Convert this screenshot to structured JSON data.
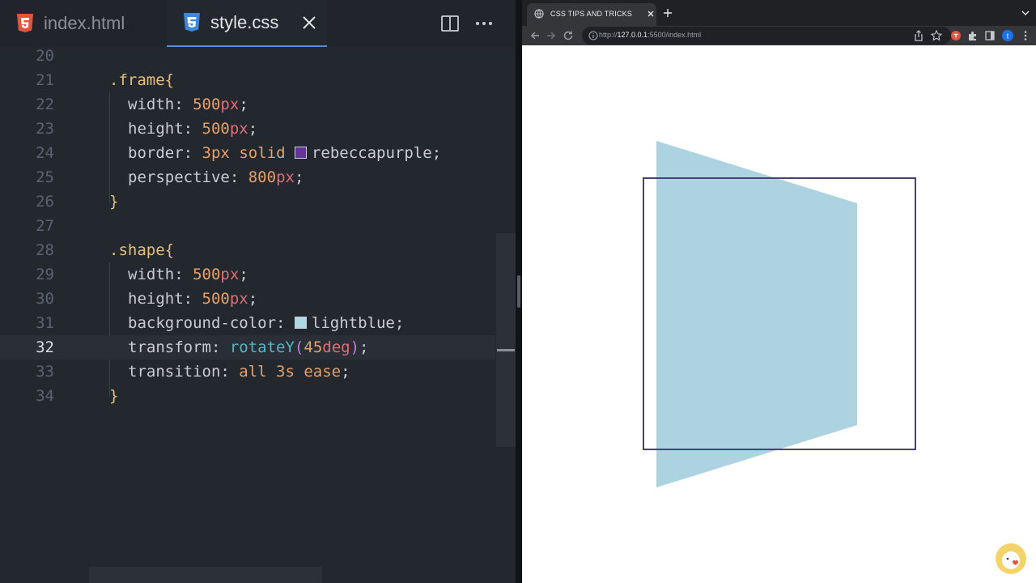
{
  "editor": {
    "tabs": [
      {
        "name": "index.html",
        "icon": "html5-icon"
      },
      {
        "name": "style.css",
        "icon": "css3-icon"
      }
    ],
    "lines": [
      {
        "num": "20"
      },
      {
        "num": "21",
        "selector": ".frame",
        "brace": "{"
      },
      {
        "num": "22",
        "prop": "width",
        "value_num": "500",
        "value_unit": "px"
      },
      {
        "num": "23",
        "prop": "height",
        "value_num": "500",
        "value_unit": "px"
      },
      {
        "num": "24",
        "prop": "border",
        "value_a": "3px",
        "value_b": "solid",
        "color_name": "rebeccapurple",
        "color_hex": "#663399"
      },
      {
        "num": "25",
        "prop": "perspective",
        "value_num": "800",
        "value_unit": "px"
      },
      {
        "num": "26",
        "brace": "}"
      },
      {
        "num": "27"
      },
      {
        "num": "28",
        "selector": ".shape",
        "brace": "{"
      },
      {
        "num": "29",
        "prop": "width",
        "value_num": "500",
        "value_unit": "px"
      },
      {
        "num": "30",
        "prop": "height",
        "value_num": "500",
        "value_unit": "px"
      },
      {
        "num": "31",
        "prop": "background-color",
        "color_name": "lightblue",
        "color_hex": "#add8e6"
      },
      {
        "num": "32",
        "prop": "transform",
        "fn": "rotateY",
        "arg_num": "45",
        "arg_unit": "deg"
      },
      {
        "num": "33",
        "prop": "transition",
        "value": "all 3s ease"
      },
      {
        "num": "34",
        "brace": "}"
      }
    ],
    "active_line": "32"
  },
  "browser": {
    "tab_title": "CSS TIPS AND TRICKS",
    "url_prefix": "http://",
    "url_host": "127.0.0.1",
    "url_rest": ":5500/index.html",
    "profile_initial": "t"
  },
  "preview": {
    "frame_border_color": "#4b3f7a",
    "shape_color": "#add3e0"
  }
}
